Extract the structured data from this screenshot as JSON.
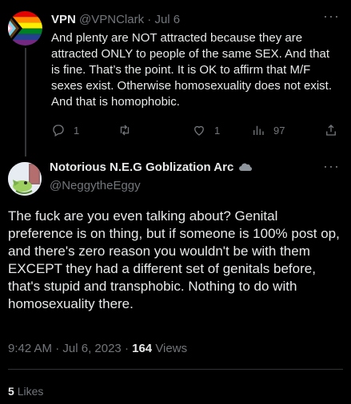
{
  "parent_tweet": {
    "display_name": "VPN",
    "handle": "@VPNClark",
    "date": "Jul 6",
    "text": "And plenty are NOT attracted because they are attracted ONLY to people of the same SEX. And that is fine. That’s the point. It is OK to affirm that M/F sexes exist. Otherwise homosexuality does not exist. And that is homophobic.",
    "replies": "1",
    "retweets": "",
    "likes": "1",
    "views": "97"
  },
  "main_tweet": {
    "display_name": "Notorious N.E.G Goblization Arc",
    "handle": "@NeggytheEggy",
    "text": "The fuck are you even talking about? Genital preference is on thing, but if someone is 100% post op, and there's zero reason you wouldn't be with them EXCEPT they had a different set of genitals before, that's stupid and transphobic. Nothing to do with homosexuality there.",
    "time": "9:42 AM",
    "date": "Jul 6, 2023",
    "views_count": "164",
    "views_label": "Views",
    "likes_count": "5",
    "likes_label": "Likes"
  },
  "more_label": "···",
  "colors": {
    "background": "#000000",
    "text": "#e7e9ea",
    "muted": "#71767b",
    "divider": "#2f3336"
  },
  "icons": [
    "pride-flag-avatar",
    "reply-icon",
    "retweet-icon",
    "like-icon",
    "views-icon",
    "share-icon",
    "goblin-avatar",
    "cloud-emoji-icon"
  ]
}
